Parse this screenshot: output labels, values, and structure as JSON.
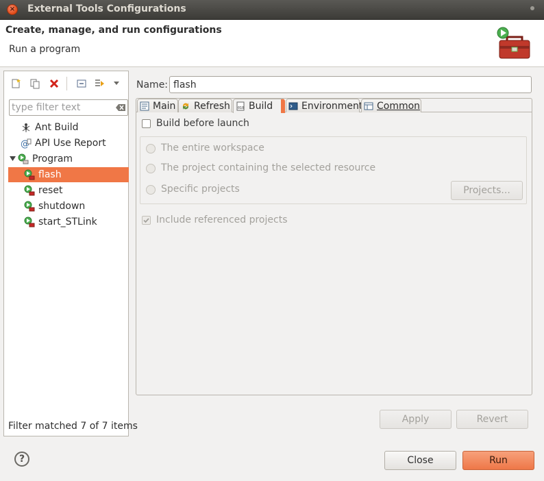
{
  "window": {
    "title": "External Tools Configurations"
  },
  "header": {
    "title": "Create, manage, and run configurations",
    "message": "Run a program"
  },
  "toolbar": {
    "icons": [
      "new-configuration-icon",
      "duplicate-icon",
      "delete-icon",
      "collapse-all-icon",
      "filter-icon",
      "view-menu-icon"
    ]
  },
  "filter": {
    "placeholder": "type filter text",
    "value": ""
  },
  "tree": {
    "items": [
      {
        "label": "Ant Build",
        "icon": "ant-icon",
        "level": 0
      },
      {
        "label": "API Use Report",
        "icon": "api-report-icon",
        "level": 0
      },
      {
        "label": "Program",
        "icon": "program-icon",
        "level": 0,
        "expanded": true
      },
      {
        "label": "flash",
        "icon": "program-launch-icon",
        "level": 1,
        "selected": true
      },
      {
        "label": "reset",
        "icon": "program-launch-icon",
        "level": 1
      },
      {
        "label": "shutdown",
        "icon": "program-launch-icon",
        "level": 1
      },
      {
        "label": "start_STLink",
        "icon": "program-launch-icon",
        "level": 1
      }
    ]
  },
  "status": "Filter matched 7 of 7 items",
  "name_field": {
    "label": "Name:",
    "value": "flash"
  },
  "tabs": [
    {
      "label": "Main",
      "icon": "main-tab-icon"
    },
    {
      "label": "Refresh",
      "icon": "refresh-tab-icon"
    },
    {
      "label": "Build",
      "icon": "build-tab-icon",
      "active": true
    },
    {
      "label": "Environment",
      "icon": "environment-tab-icon"
    },
    {
      "label": "Common",
      "icon": "common-tab-icon"
    }
  ],
  "build_tab": {
    "build_before_launch": {
      "label": "Build before launch",
      "checked": false
    },
    "scope_options": [
      {
        "label": "The entire workspace",
        "enabled": false
      },
      {
        "label": "The project containing the selected resource",
        "enabled": false
      },
      {
        "label": "Specific projects",
        "enabled": false
      }
    ],
    "projects_button": "Projects...",
    "include_referenced": {
      "label": "Include referenced projects",
      "checked": true,
      "enabled": false
    }
  },
  "buttons": {
    "apply": "Apply",
    "revert": "Revert",
    "close": "Close",
    "run": "Run"
  },
  "colors": {
    "selection": "#f07746",
    "run_button": "#ee7748",
    "titlebar": "#3c3b37"
  }
}
